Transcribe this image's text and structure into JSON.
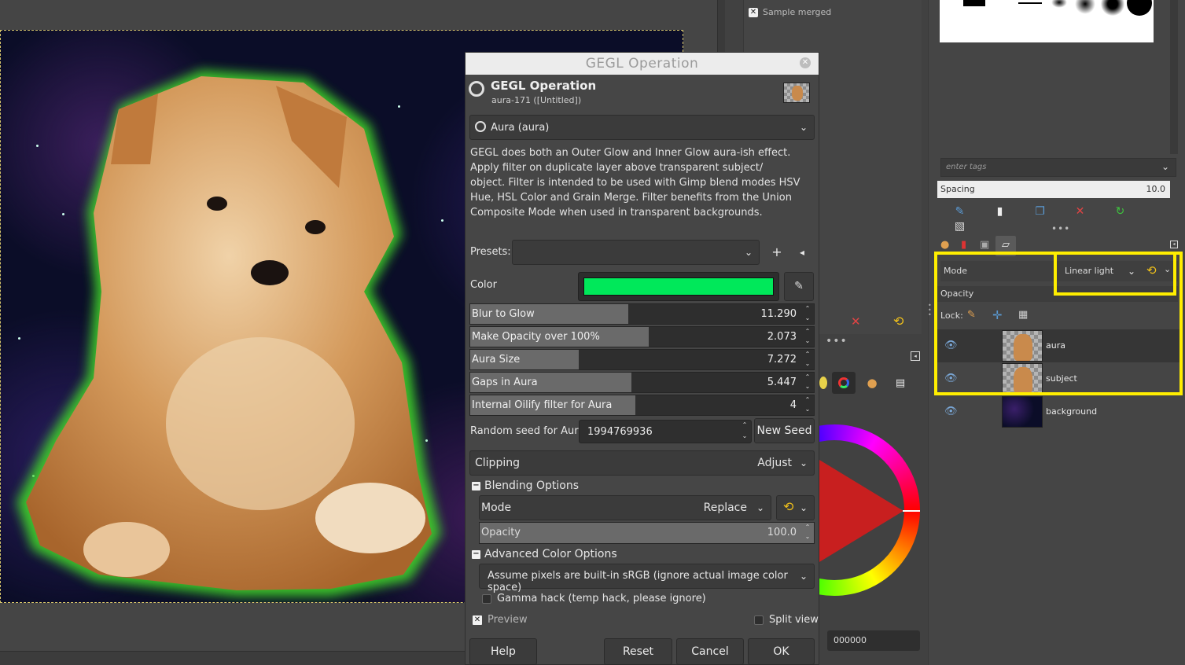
{
  "dialog": {
    "window_title": "GEGL Operation",
    "header_title": "GEGL Operation",
    "header_subtitle": "aura-171 ([Untitled])",
    "operation": "Aura (aura)",
    "description": "GEGL does both an Outer Glow and Inner Glow aura-ish effect. Apply filter on duplicate layer above transparent subject/ object. Filter is intended to be used with Gimp blend modes HSV Hue, HSL Color and Grain Merge. Filter benefits from the Union Composite Mode when used in transparent backgrounds.",
    "presets_label": "Presets:",
    "presets_value": "",
    "color_label": "Color",
    "color_value": "#00e85a",
    "sliders": [
      {
        "label": "Blur to Glow",
        "value": "11.290",
        "fill": 0.46
      },
      {
        "label": "Make Opacity over 100%",
        "value": "2.073",
        "fill": 0.52
      },
      {
        "label": "Aura Size",
        "value": "7.272",
        "fill": 0.315
      },
      {
        "label": "Gaps in Aura",
        "value": "5.447",
        "fill": 0.47
      },
      {
        "label": "Internal Oilify filter for Aura",
        "value": "4",
        "fill": 0.48
      }
    ],
    "seed_label": "Random seed for Aura",
    "seed_value": "1994769936",
    "new_seed_label": "New Seed",
    "clipping_label": "Clipping",
    "clipping_value": "Adjust",
    "blending_section": "Blending Options",
    "mode_label": "Mode",
    "mode_value": "Replace",
    "opacity_label": "Opacity",
    "opacity_value": "100.0",
    "advanced_section": "Advanced Color Options",
    "color_option_value": "Assume pixels are built-in sRGB (ignore actual image color space)",
    "gamma_label": "Gamma hack (temp hack, please ignore)",
    "preview_label": "Preview",
    "split_view_label": "Split view",
    "buttons": {
      "help": "Help",
      "reset": "Reset",
      "cancel": "Cancel",
      "ok": "OK"
    }
  },
  "mid_dock": {
    "sample_merged_label": "Sample merged",
    "hex_value": "000000"
  },
  "right_dock": {
    "tags_placeholder": "enter tags",
    "spacing_label": "Spacing",
    "spacing_value": "10.0",
    "mode_label": "Mode",
    "mode_value": "Linear light",
    "opacity_label": "Opacity",
    "lock_label": "Lock:",
    "layers": [
      {
        "name": "aura",
        "visible": true
      },
      {
        "name": "subject",
        "visible": true
      },
      {
        "name": "background",
        "visible": true
      }
    ],
    "highlight_color": "#ffee00"
  }
}
